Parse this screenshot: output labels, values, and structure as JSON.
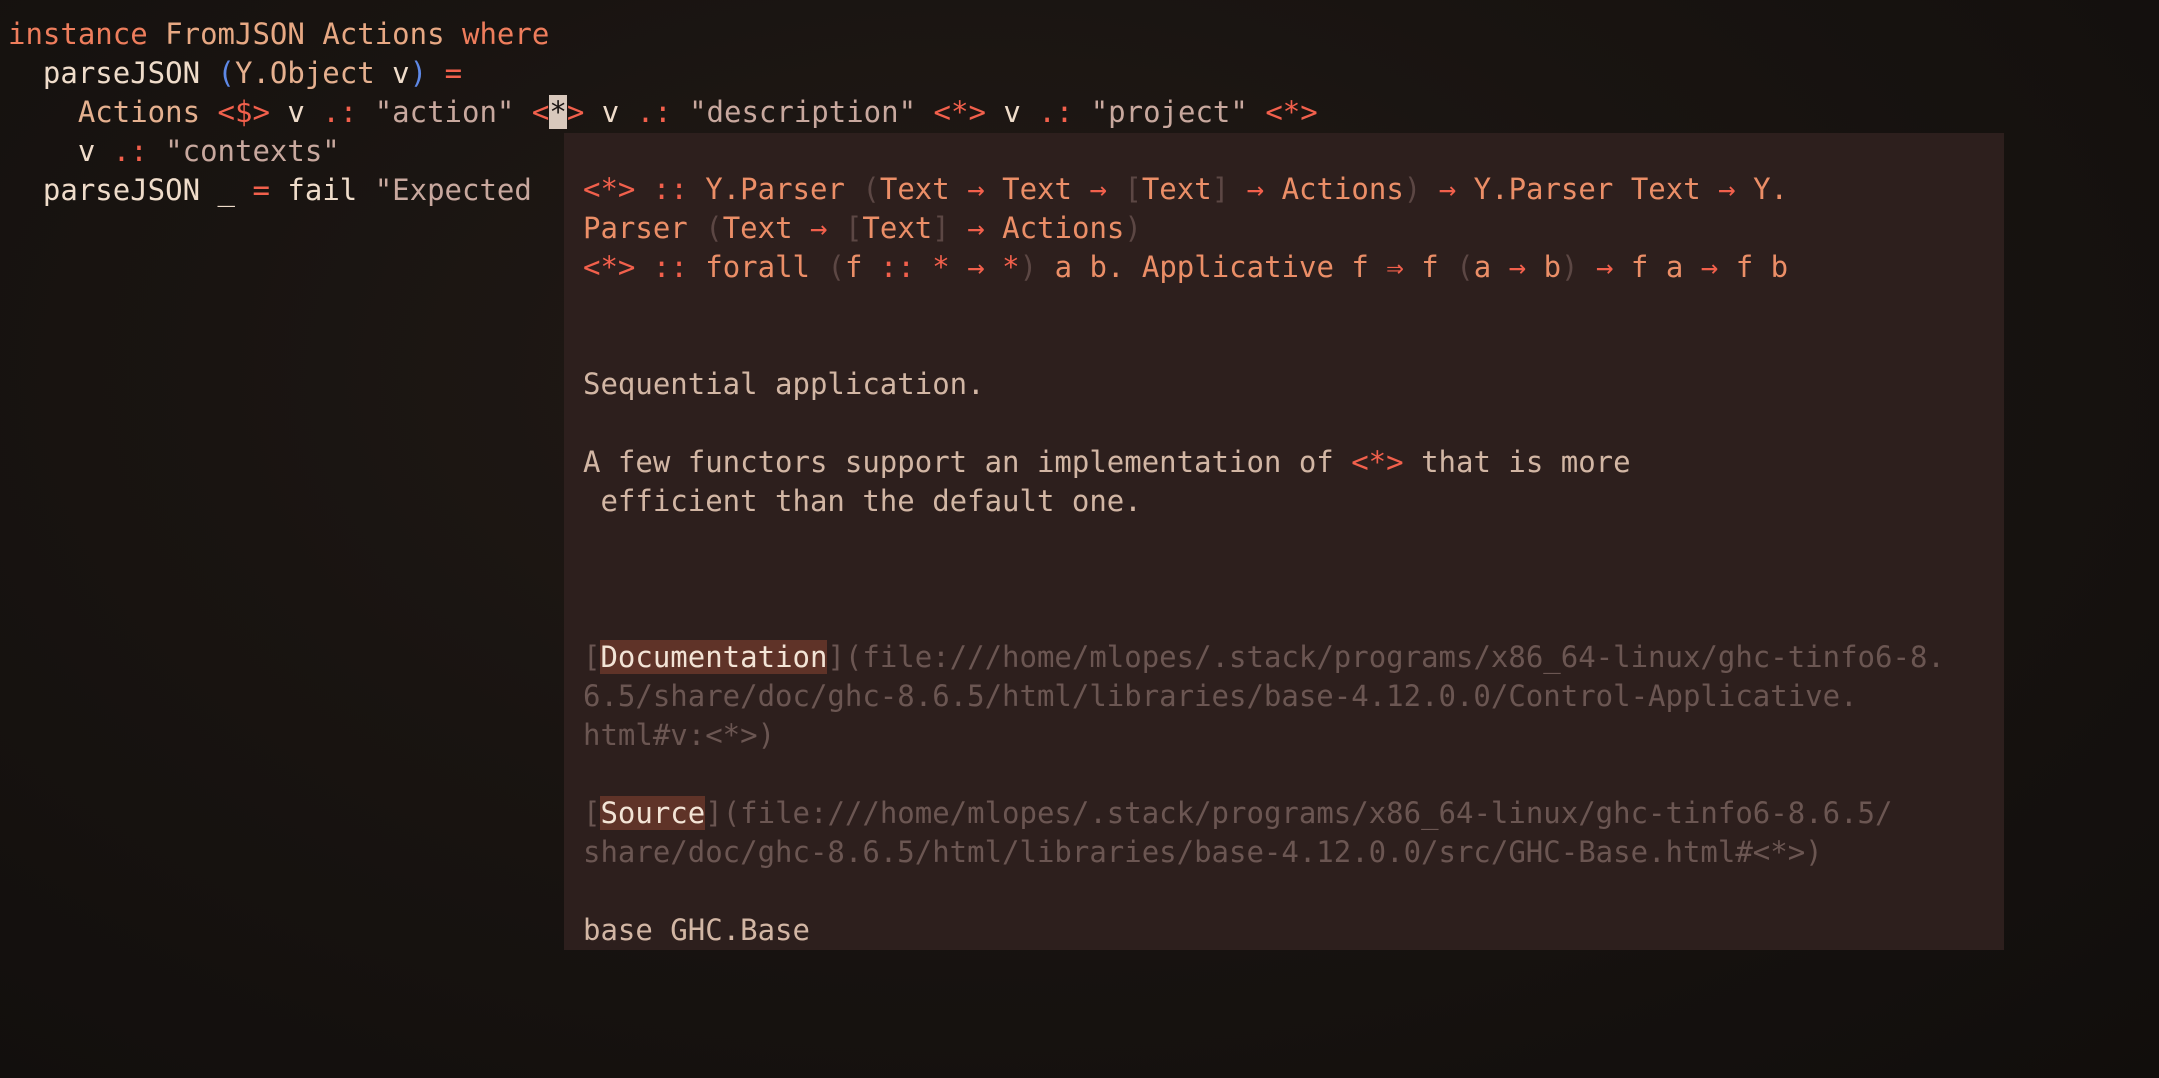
{
  "code": {
    "line1": {
      "kw_instance": "instance",
      "class_name": "FromJSON",
      "type_name": "Actions",
      "kw_where": "where"
    },
    "line2": {
      "fn": "parseJSON",
      "open_paren": "(",
      "pattern_con": "Y.Object",
      "pattern_var": "v",
      "close_paren": ")",
      "eq": "="
    },
    "line3": {
      "con": "Actions",
      "op_fmap": "<$>",
      "v1": "v",
      "op_dot1": ".:",
      "s1": "\"action\"",
      "op_ap1_pre": "<",
      "op_ap1_cursor": "*",
      "op_ap1_post": ">",
      "v2": "v",
      "op_dot2": ".:",
      "s2": "\"description\"",
      "op_ap2": "<*>",
      "v3": "v",
      "op_dot3": ".:",
      "s3": "\"project\"",
      "op_ap3": "<*>"
    },
    "line4": {
      "v": "v",
      "op_dot": ".:",
      "s": "\"contexts\""
    },
    "line5": {
      "fn": "parseJSON",
      "wild": "_",
      "eq": "=",
      "kw_fail": "fail",
      "s_partial": "\"Expected"
    }
  },
  "hover": {
    "sig1_a": {
      "op": "<*>",
      "colons": "::",
      "t1": "Y.Parser",
      "p1": "(",
      "t2": "Text",
      "arr1": "→",
      "t3": "Text",
      "arr2": "→",
      "lb": "[",
      "t4": "Text",
      "rb": "]",
      "arr3": "→",
      "t5": "Actions",
      "p2": ")",
      "arr4": "→",
      "t6": "Y.Parser",
      "t7": "Text",
      "arr5": "→",
      "t8": "Y."
    },
    "sig1_b": {
      "t1": "Parser",
      "p1": "(",
      "t2": "Text",
      "arr1": "→",
      "lb": "[",
      "t3": "Text",
      "rb": "]",
      "arr2": "→",
      "t4": "Actions",
      "p2": ")"
    },
    "sig2": {
      "op": "<*>",
      "colons": "::",
      "forall": "forall",
      "p1": "(",
      "f": "f",
      "colons2": "::",
      "star1": "*",
      "arr1": "→",
      "star2": "*",
      "p2": ")",
      "ab": "a b.",
      "applicative": "Applicative",
      "f2": "f",
      "darr": "⇒",
      "f3": "f",
      "p3": "(",
      "a1": "a",
      "arr2": "→",
      "b1": "b",
      "p4": ")",
      "arr3": "→",
      "f4": "f",
      "a2": "a",
      "arr4": "→",
      "f5": "f",
      "b2": "b"
    },
    "summary": "Sequential application.",
    "para_a1": "A few functors support an implementation of ",
    "para_op": "<*>",
    "para_a2": " that is more",
    "para_b": " efficient than the default one.",
    "doc_link": {
      "lb": "[",
      "label": "Documentation",
      "rest1": "](file:///home/mlopes/.stack/programs/x86_64-linux/ghc-tinfo6-8.",
      "rest2": "6.5/share/doc/ghc-8.6.5/html/libraries/base-4.12.0.0/Control-Applicative.",
      "rest3": "html#v:<*>)"
    },
    "source_link": {
      "lb": "[",
      "label": "Source",
      "rest1": "](file:///home/mlopes/.stack/programs/x86_64-linux/ghc-tinfo6-8.6.5/",
      "rest2": "share/doc/ghc-8.6.5/html/libraries/base-4.12.0.0/src/GHC-Base.html#<*>)"
    },
    "module": "base GHC.Base"
  },
  "colors": {
    "background": "#191411",
    "popup_bg": "#2d1f1d",
    "keyword": "#ee7d5c",
    "operator": "#f2604c",
    "string": "#c8a89e",
    "paren_blue": "#5e88e6",
    "link_highlight": "#5f3328"
  }
}
